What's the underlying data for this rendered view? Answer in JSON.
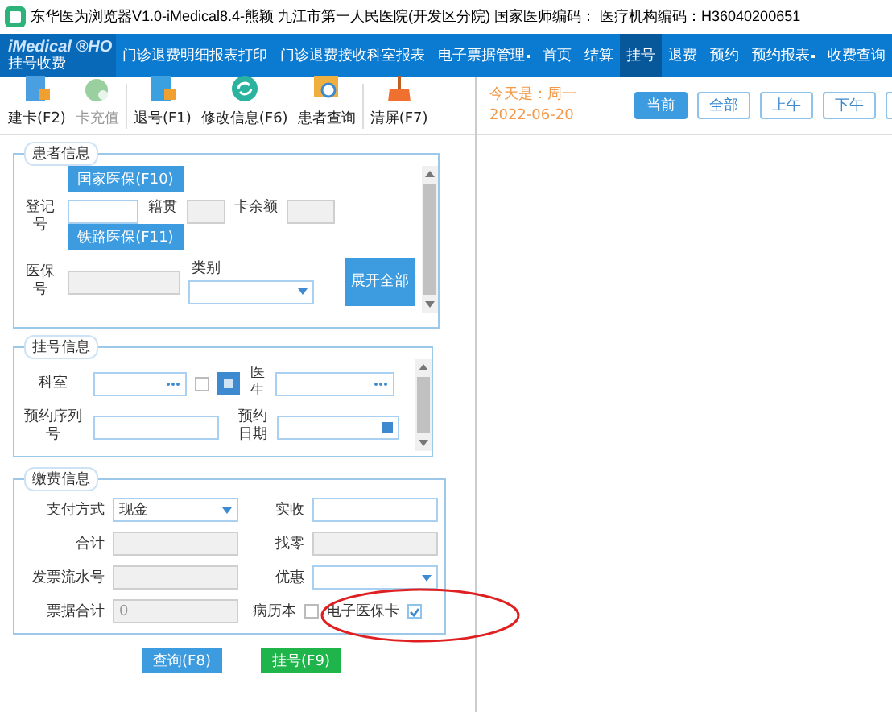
{
  "window": {
    "title": "东华医为浏览器V1.0-iMedical8.4-熊颖 九江市第一人民医院(开发区分院) 国家医师编码：  医疗机构编码：H36040200651"
  },
  "brand": {
    "name": "iMedical",
    "mark": "®HO",
    "sub": "挂号收费"
  },
  "nav": [
    {
      "label": "门诊退费明细报表打印",
      "selected": false,
      "dropdown": false
    },
    {
      "label": "门诊退费接收科室报表",
      "selected": false,
      "dropdown": false
    },
    {
      "label": "电子票据管理",
      "selected": false,
      "dropdown": true
    },
    {
      "label": "首页",
      "selected": false,
      "dropdown": false
    },
    {
      "label": "结算",
      "selected": false,
      "dropdown": false
    },
    {
      "label": "挂号",
      "selected": true,
      "dropdown": false
    },
    {
      "label": "退费",
      "selected": false,
      "dropdown": false
    },
    {
      "label": "预约",
      "selected": false,
      "dropdown": false
    },
    {
      "label": "预约报表",
      "selected": false,
      "dropdown": true
    },
    {
      "label": "收费查询",
      "selected": false,
      "dropdown": false
    }
  ],
  "toolbar": [
    {
      "label": "建卡(F2)",
      "disabled": false,
      "kind": "card"
    },
    {
      "label": "卡充值",
      "disabled": true,
      "kind": "money"
    },
    {
      "label": "退号(F1)",
      "disabled": false,
      "kind": "return"
    },
    {
      "label": "修改信息(F6)",
      "disabled": false,
      "kind": "refresh"
    },
    {
      "label": "患者查询",
      "disabled": false,
      "kind": "search"
    },
    {
      "label": "清屏(F7)",
      "disabled": false,
      "kind": "broom"
    }
  ],
  "today": {
    "label": "今天是：周一",
    "date": "2022-06-20"
  },
  "periods": [
    {
      "label": "当前",
      "selected": true
    },
    {
      "label": "全部",
      "selected": false
    },
    {
      "label": "上午",
      "selected": false
    },
    {
      "label": "下午",
      "selected": false
    }
  ],
  "patient": {
    "legend": "患者信息",
    "national_button": "国家医保(F10)",
    "reg_label": "登记号",
    "native_label": "籍贯",
    "balance_label": "卡余额",
    "rail_button": "铁路医保(F11)",
    "insurance_label": "医保号",
    "category_label": "类别",
    "expand_button": "展开全部"
  },
  "registration": {
    "legend": "挂号信息",
    "dept_label": "科室",
    "doctor_label": "医生",
    "seq_label": "预约序列号",
    "date_label": "预约日期",
    "dept_checkbox": {
      "checked": false
    }
  },
  "payment": {
    "legend": "缴费信息",
    "fields": [
      {
        "label": "支付方式",
        "kind": "select",
        "value": "现金"
      },
      {
        "label": "实收",
        "kind": "input"
      },
      {
        "label": "合计",
        "kind": "readonly"
      },
      {
        "label": "找零",
        "kind": "readonly"
      },
      {
        "label": "发票流水号",
        "kind": "readonly"
      },
      {
        "label": "优惠",
        "kind": "select"
      },
      {
        "label": "票据合计",
        "kind": "readonly",
        "value": "0"
      }
    ],
    "checkboxes": [
      {
        "label": "病历本",
        "checked": false
      },
      {
        "label": "电子医保卡",
        "checked": true
      }
    ]
  },
  "actions": [
    {
      "label": "查询(F8)",
      "kind": "primary"
    },
    {
      "label": "挂号(F9)",
      "kind": "success"
    }
  ]
}
